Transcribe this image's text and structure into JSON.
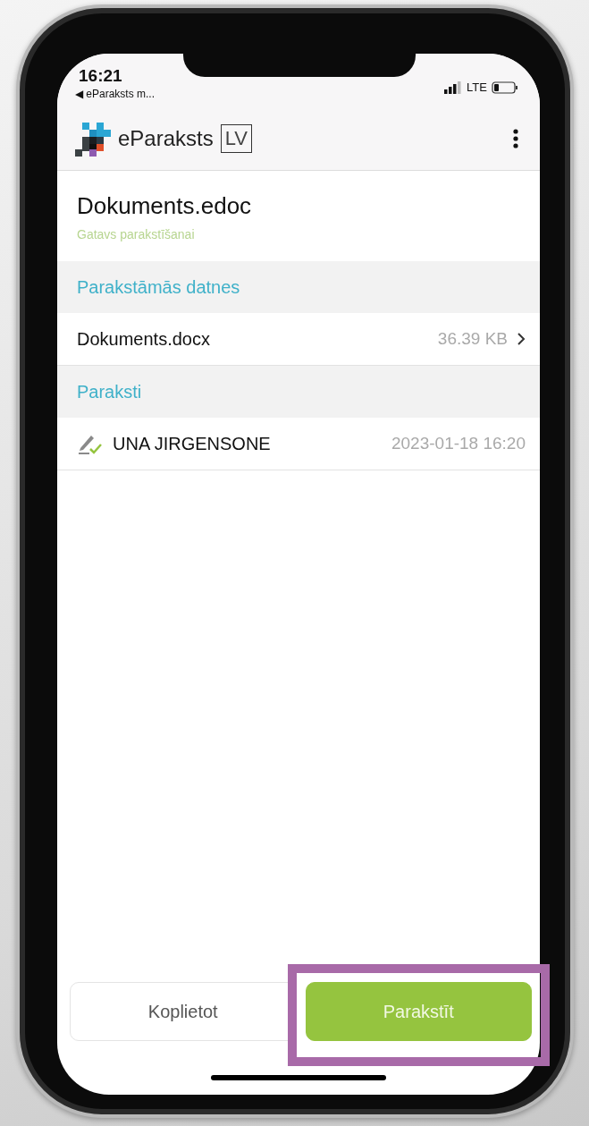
{
  "status_bar": {
    "time": "16:21",
    "back_link": "◀ eParaksts m...",
    "network": "LTE"
  },
  "header": {
    "app_name": "eParaksts",
    "badge": "LV"
  },
  "document": {
    "title": "Dokuments.edoc",
    "status": "Gatavs parakstīšanai"
  },
  "sections": [
    {
      "title": "Parakstāmās datnes",
      "rows": [
        {
          "kind": "file",
          "name": "Dokuments.docx",
          "detail": "36.39 KB"
        }
      ]
    },
    {
      "title": "Paraksti",
      "rows": [
        {
          "kind": "signature",
          "name": "UNA JIRGENSONE",
          "detail": "2023-01-18 16:20"
        }
      ]
    }
  ],
  "buttons": [
    {
      "label": "Koplietot",
      "kind": "secondary",
      "highlighted": false
    },
    {
      "label": "Parakstīt",
      "kind": "primary",
      "highlighted": true
    }
  ]
}
